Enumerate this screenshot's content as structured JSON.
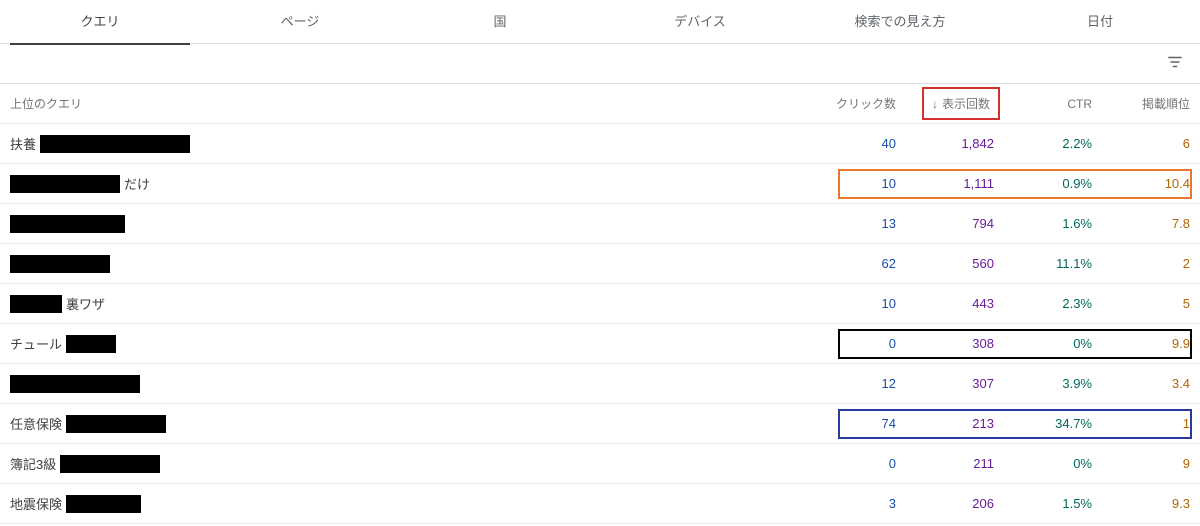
{
  "tabs": [
    "クエリ",
    "ページ",
    "国",
    "デバイス",
    "検索での見え方",
    "日付"
  ],
  "active_tab_index": 0,
  "filter_icon": "filter-icon",
  "columns": {
    "query": "上位のクエリ",
    "clicks": "クリック数",
    "impressions": "表示回数",
    "ctr": "CTR",
    "position": "掲載順位"
  },
  "sorted_by": "impressions",
  "sort_direction": "desc",
  "rows": [
    {
      "query_prefix": "扶養",
      "redactions": [
        150
      ],
      "query_suffix": "",
      "clicks": "40",
      "impressions": "1,842",
      "ctr": "2.2%",
      "position": "6",
      "highlight": null
    },
    {
      "query_prefix": "",
      "redactions": [
        110
      ],
      "query_suffix": "だけ",
      "clicks": "10",
      "impressions": "1,111",
      "ctr": "0.9%",
      "position": "10.4",
      "highlight": "orange"
    },
    {
      "query_prefix": "",
      "redactions": [
        115
      ],
      "query_suffix": "",
      "clicks": "13",
      "impressions": "794",
      "ctr": "1.6%",
      "position": "7.8",
      "highlight": null
    },
    {
      "query_prefix": "",
      "redactions": [
        100
      ],
      "query_suffix": "",
      "clicks": "62",
      "impressions": "560",
      "ctr": "11.1%",
      "position": "2",
      "highlight": null
    },
    {
      "query_prefix": "",
      "redactions": [
        52
      ],
      "query_suffix": "裏ワザ",
      "clicks": "10",
      "impressions": "443",
      "ctr": "2.3%",
      "position": "5",
      "highlight": null
    },
    {
      "query_prefix": "チュール",
      "redactions": [
        50
      ],
      "query_suffix": "",
      "clicks": "0",
      "impressions": "308",
      "ctr": "0%",
      "position": "9.9",
      "highlight": "black"
    },
    {
      "query_prefix": "",
      "redactions": [
        130
      ],
      "query_suffix": "",
      "clicks": "12",
      "impressions": "307",
      "ctr": "3.9%",
      "position": "3.4",
      "highlight": null
    },
    {
      "query_prefix": "任意保険",
      "redactions": [
        100
      ],
      "query_suffix": "",
      "clicks": "74",
      "impressions": "213",
      "ctr": "34.7%",
      "position": "1",
      "highlight": "blue"
    },
    {
      "query_prefix": "簿記3級",
      "redactions": [
        100
      ],
      "query_suffix": "",
      "clicks": "0",
      "impressions": "211",
      "ctr": "0%",
      "position": "9",
      "highlight": null
    },
    {
      "query_prefix": "地震保険",
      "redactions": [
        75
      ],
      "query_suffix": "",
      "clicks": "3",
      "impressions": "206",
      "ctr": "1.5%",
      "position": "9.3",
      "highlight": null
    }
  ]
}
